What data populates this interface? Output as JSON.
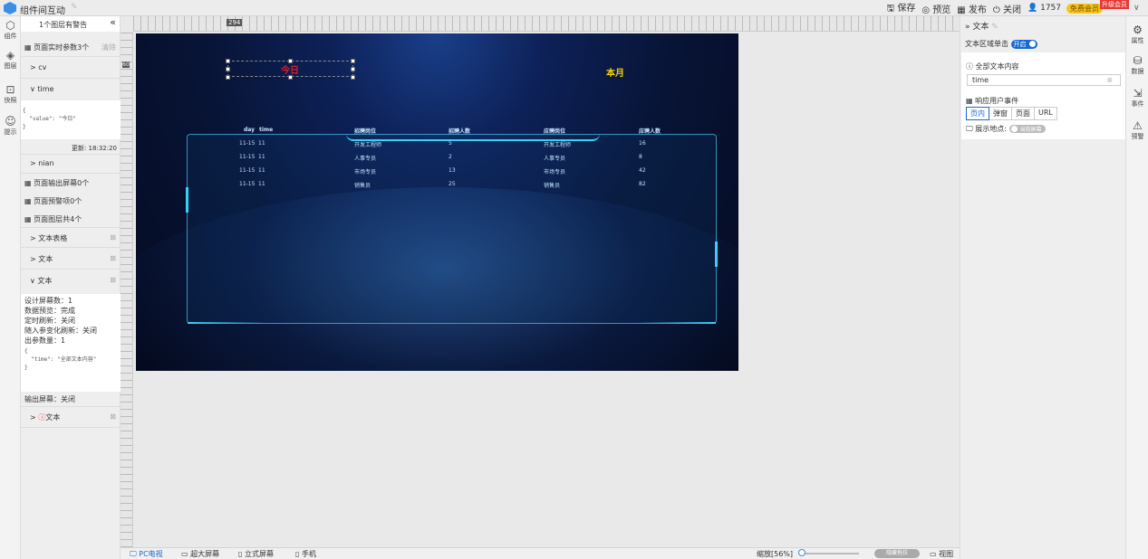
{
  "app": {
    "title": "组件间互动"
  },
  "topbar": {
    "save": "保存",
    "preview": "预览",
    "publish": "发布",
    "close": "关闭",
    "user_count": "1757",
    "free_badge": "免费会员",
    "upgrade_badge": "升级会员"
  },
  "left_rail": [
    {
      "label": "组件",
      "icon": "cube-icon"
    },
    {
      "label": "图层",
      "icon": "layers-icon"
    },
    {
      "label": "快照",
      "icon": "snapshot-icon"
    },
    {
      "label": "提示",
      "icon": "tip-icon"
    }
  ],
  "left_panel": {
    "warning": "1个图层有警告",
    "collapse": "«",
    "params_title": "页面实时参数3个",
    "clear": "清除",
    "param_cv": "> cv",
    "param_time": "∨ time",
    "time_json": [
      "{",
      "  \"value\": \"今日\"",
      "}"
    ],
    "updated": "更新: 18:32:20",
    "param_nian": "> nian",
    "screens_out": "页面输出屏幕0个",
    "warnings": "页面预警项0个",
    "layers": "页面图层共4个",
    "layer_table": "> 文本表格",
    "layer_text1": "> 文本",
    "layer_text2": "∨ 文本",
    "text_info": [
      "设计屏幕数：1",
      "数据预览：完成",
      "定时刷新：关闭",
      "随入参变化刷新：关闭",
      "出参数量：1"
    ],
    "text_json": [
      "{",
      "  \"time\": \"全部文本内容\"",
      "}"
    ],
    "output_screen": "输出屏幕：关闭",
    "layer_text3": "文本"
  },
  "ruler": {
    "h_mark": "294",
    "v_mark": "60"
  },
  "canvas": {
    "today": "今日",
    "month": "本月",
    "table_headers": [
      "day",
      "time",
      "招聘岗位",
      "招聘人数",
      "应聘岗位",
      "应聘人数"
    ],
    "rows": [
      [
        "11-15",
        "11",
        "开发工程师",
        "5",
        "开发工程师",
        "16"
      ],
      [
        "11-15",
        "11",
        "人事专员",
        "2",
        "人事专员",
        "8"
      ],
      [
        "11-15",
        "11",
        "市场专员",
        "13",
        "市场专员",
        "42"
      ],
      [
        "11-15",
        "11",
        "销售员",
        "25",
        "销售员",
        "82"
      ]
    ]
  },
  "bottombar": {
    "tabs": [
      "PC电视",
      "超大屏幕",
      "立式屏幕",
      "手机"
    ],
    "zoom": "缩放[56%]",
    "toggle": "隐藏拖拉",
    "view": "视图"
  },
  "right_panel": {
    "title": "» 文本",
    "click_label": "文本区域单击",
    "click_toggle": "开启",
    "content_label": "全部文本内容",
    "content_value": "time",
    "event_label": "响应用户事件",
    "event_options": [
      "页内",
      "弹窗",
      "页面",
      "URL"
    ],
    "location_label": "展示地点:",
    "location_toggle": "当前屏幕"
  },
  "right_rail": [
    {
      "label": "属性",
      "icon": "properties-icon"
    },
    {
      "label": "数据",
      "icon": "database-icon"
    },
    {
      "label": "事件",
      "icon": "event-icon"
    },
    {
      "label": "预警",
      "icon": "alarm-icon"
    }
  ]
}
